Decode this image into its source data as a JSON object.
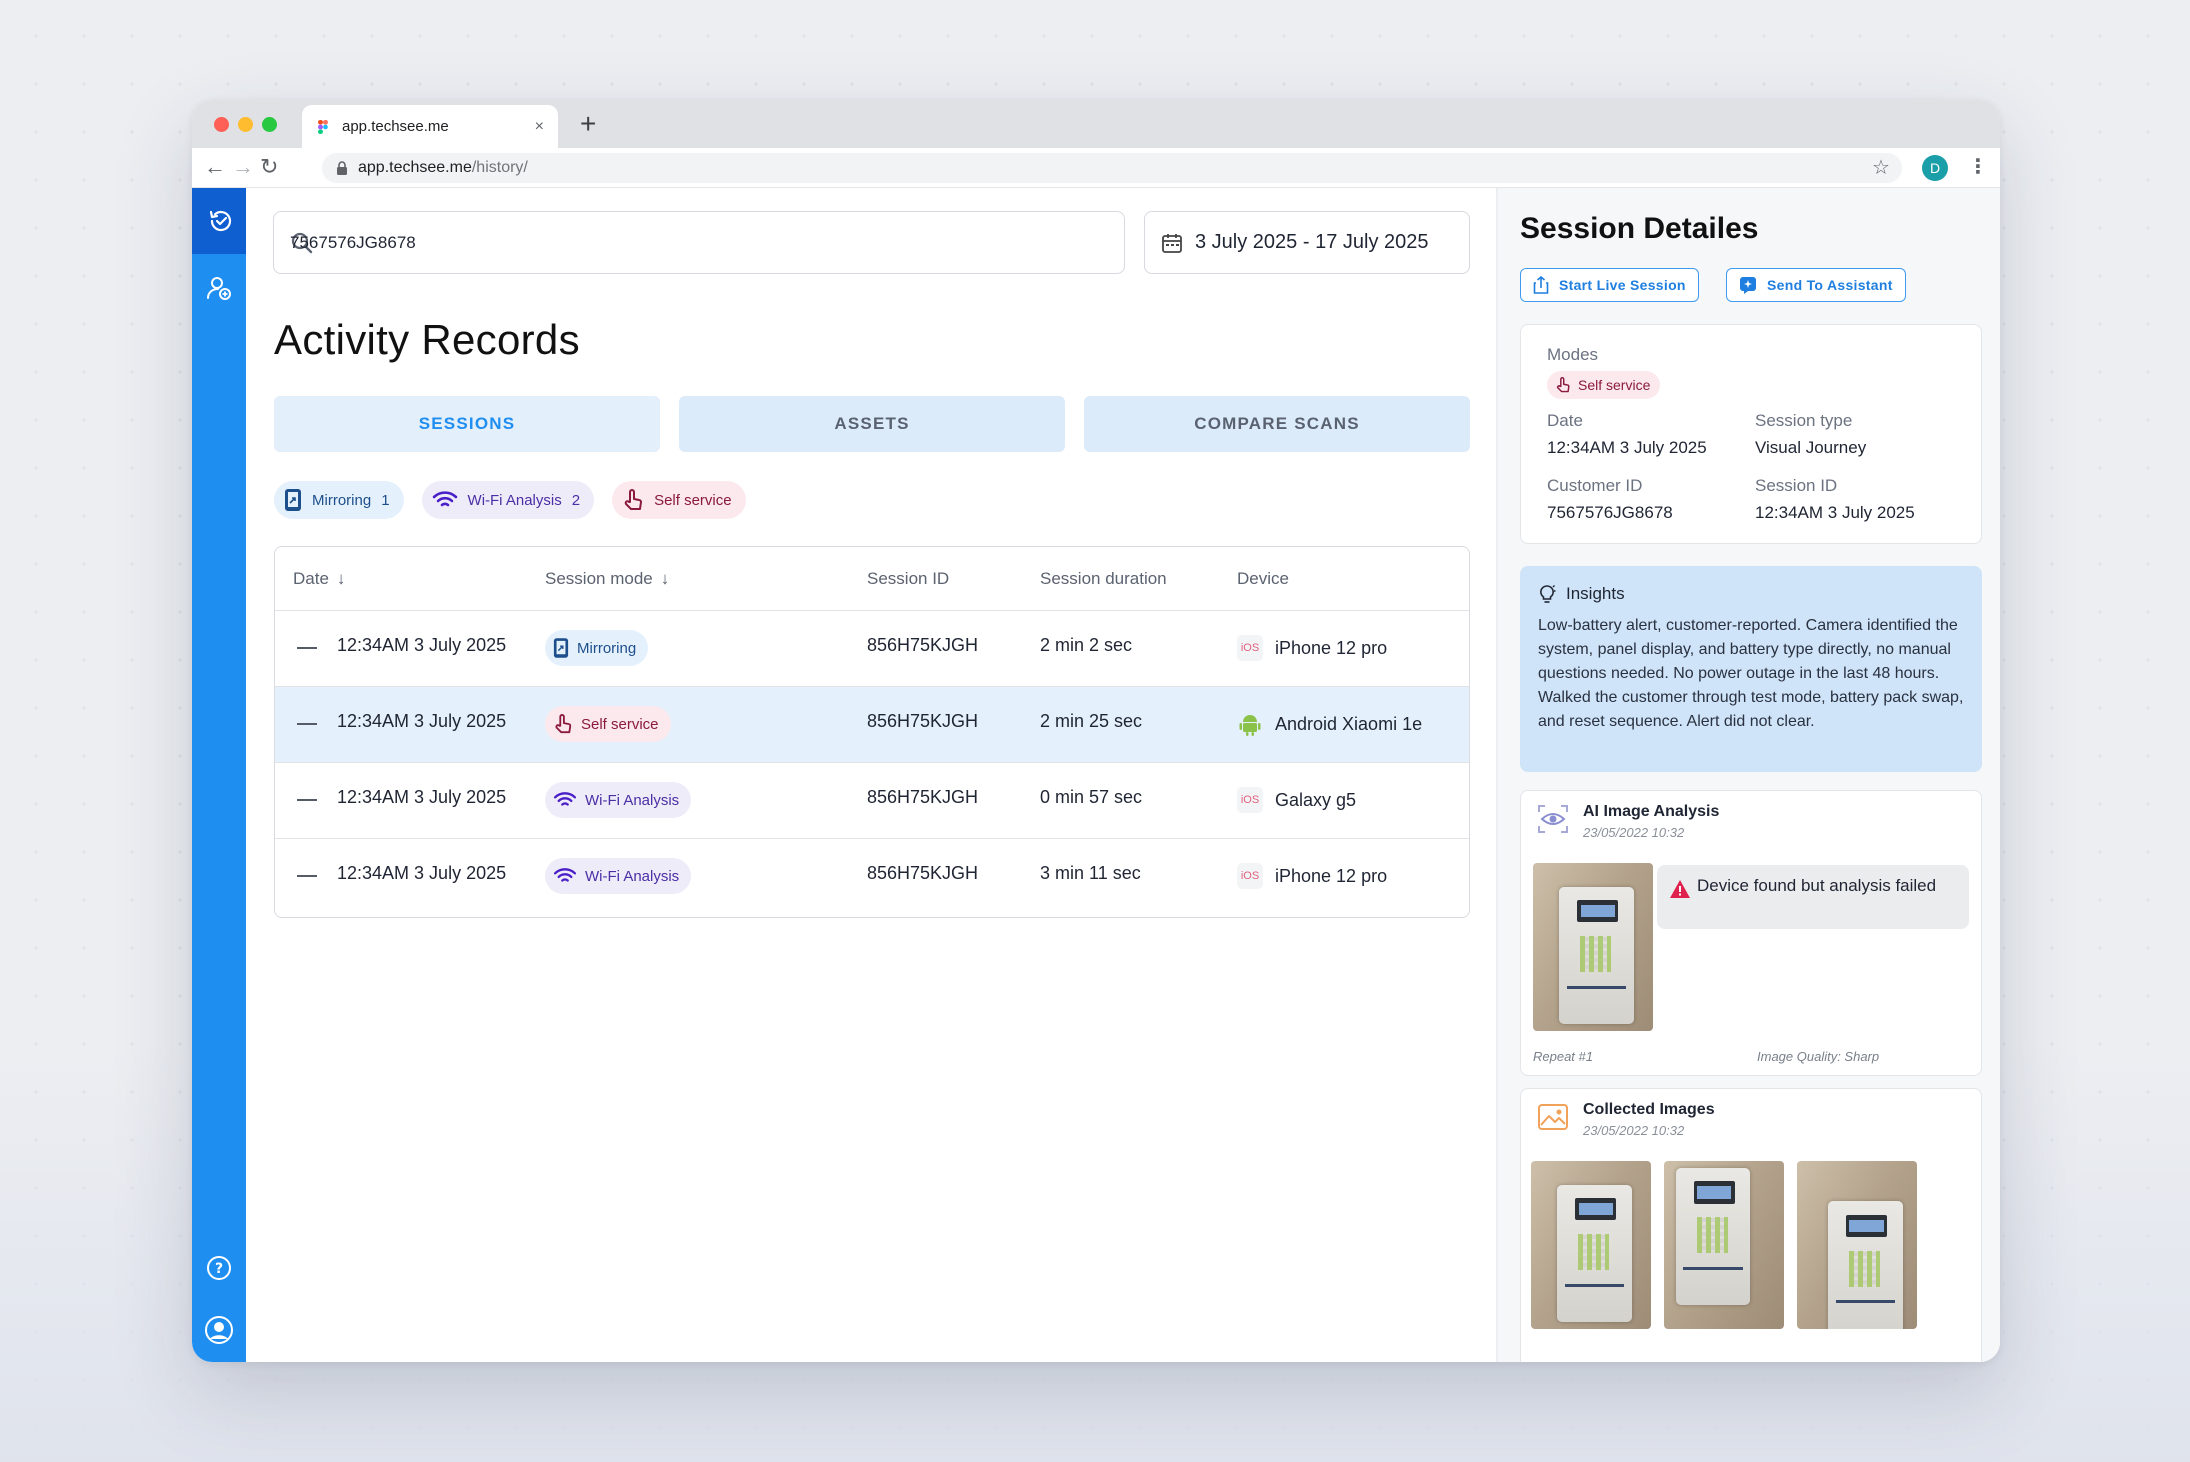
{
  "browser": {
    "tab_title": "app.techsee.me",
    "tab_close": "×",
    "new_tab": "+",
    "url_host": "app.techsee.me",
    "url_path": "/history/",
    "profile_initial": "D"
  },
  "search": {
    "value": "7567576JG8678"
  },
  "date_range": {
    "value": "3 July 2025 - 17 July 2025"
  },
  "page_title": "Activity Records",
  "tabs": [
    {
      "label": "SESSIONS",
      "active": true
    },
    {
      "label": "ASSETS",
      "active": false
    },
    {
      "label": "COMPARE SCANS",
      "active": false
    }
  ],
  "filters": [
    {
      "label": "Mirroring",
      "count": "1",
      "icon": "mirroring-icon"
    },
    {
      "label": "Wi-Fi Analysis",
      "count": "2",
      "icon": "wifi-icon"
    },
    {
      "label": "Self service",
      "count": "",
      "icon": "hand-pointer-icon"
    }
  ],
  "table": {
    "headers": {
      "date": "Date",
      "mode": "Session mode",
      "id": "Session ID",
      "duration": "Session duration",
      "device": "Device"
    },
    "rows": [
      {
        "date": "12:34AM 3 July 2025",
        "mode": "Mirroring",
        "id": "856H75KJGH",
        "duration": "2 min 2 sec",
        "os": "iOS",
        "device": "iPhone 12 pro"
      },
      {
        "date": "12:34AM 3 July 2025",
        "mode": "Self service",
        "id": "856H75KJGH",
        "duration": "2 min 25 sec",
        "os": "android",
        "device": "Android Xiaomi 1e"
      },
      {
        "date": "12:34AM 3 July 2025",
        "mode": "Wi-Fi Analysis",
        "id": "856H75KJGH",
        "duration": "0 min 57 sec",
        "os": "iOS",
        "device": "Galaxy g5"
      },
      {
        "date": "12:34AM 3 July 2025",
        "mode": "Wi-Fi Analysis",
        "id": "856H75KJGH",
        "duration": "3 min 11 sec",
        "os": "iOS",
        "device": "iPhone 12 pro"
      }
    ]
  },
  "details": {
    "title": "Session Detailes",
    "start_live": "Start Live Session",
    "send_assistant": "Send To Assistant",
    "modes_label": "Modes",
    "mode_value": "Self service",
    "date_label": "Date",
    "date_value": "12:34AM 3 July 2025",
    "type_label": "Session type",
    "type_value": "Visual Journey",
    "customer_label": "Customer ID",
    "customer_value": "7567576JG8678",
    "session_label": "Session ID",
    "session_value": "12:34AM 3 July 2025",
    "insights_title": "Insights",
    "insights_text": "Low-battery alert, customer-reported. Camera identified the system, panel display, and battery type directly, no manual questions needed. No power outage in the last 48 hours. Walked the customer through test mode, battery pack swap, and reset sequence. Alert did not clear.",
    "ai_title": "AI Image Analysis",
    "ai_date": "23/05/2022 10:32",
    "ai_warning": "Device found but analysis failed",
    "repeat": "Repeat  #1",
    "quality": "Image Quality:  Sharp",
    "collected_title": "Collected Images",
    "collected_date": "23/05/2022 10:32"
  },
  "colors": {
    "sidebar": "#1f8ef1",
    "sidebar_active": "#0f5fd0",
    "accent": "#1f8ef1",
    "selected_row": "#e4f0fb",
    "insights_bg": "#cfe4f8",
    "warning": "#e0234e"
  }
}
